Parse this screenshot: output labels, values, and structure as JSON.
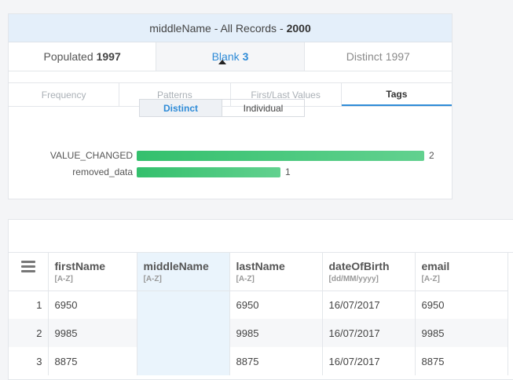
{
  "panel": {
    "title_prefix": "middleName - All Records -",
    "title_count": "2000",
    "stats": [
      {
        "label": "Populated",
        "value": "1997"
      },
      {
        "label": "Blank",
        "value": "3"
      },
      {
        "label": "Distinct",
        "value": "1997"
      }
    ],
    "subtabs": [
      "Frequency",
      "Patterns",
      "First/Last Values",
      "Tags"
    ],
    "toggle": {
      "distinct": "Distinct",
      "individual": "Individual"
    },
    "tags": [
      {
        "label": "VALUE_CHANGED",
        "count": "2",
        "fraction": 1.0
      },
      {
        "label": "removed_data",
        "count": "1",
        "fraction": 0.5
      }
    ]
  },
  "grid": {
    "columns": [
      {
        "name": "firstName",
        "type": "[A-Z]"
      },
      {
        "name": "middleName",
        "type": "[A-Z]"
      },
      {
        "name": "lastName",
        "type": "[A-Z]"
      },
      {
        "name": "dateOfBirth",
        "type": "[dd/MM/yyyy]"
      },
      {
        "name": "email",
        "type": "[A-Z]"
      }
    ],
    "rows": [
      {
        "num": "1",
        "firstName": "6950",
        "middleName": "",
        "lastName": "6950",
        "dateOfBirth": "16/07/2017",
        "email": "6950"
      },
      {
        "num": "2",
        "firstName": "9985",
        "middleName": "",
        "lastName": "9985",
        "dateOfBirth": "16/07/2017",
        "email": "9985"
      },
      {
        "num": "3",
        "firstName": "8875",
        "middleName": "",
        "lastName": "8875",
        "dateOfBirth": "16/07/2017",
        "email": "8875"
      }
    ]
  },
  "colors": {
    "accent": "#2e8bd7",
    "bar": "#34c06d",
    "header_bg": "#e4effa"
  }
}
